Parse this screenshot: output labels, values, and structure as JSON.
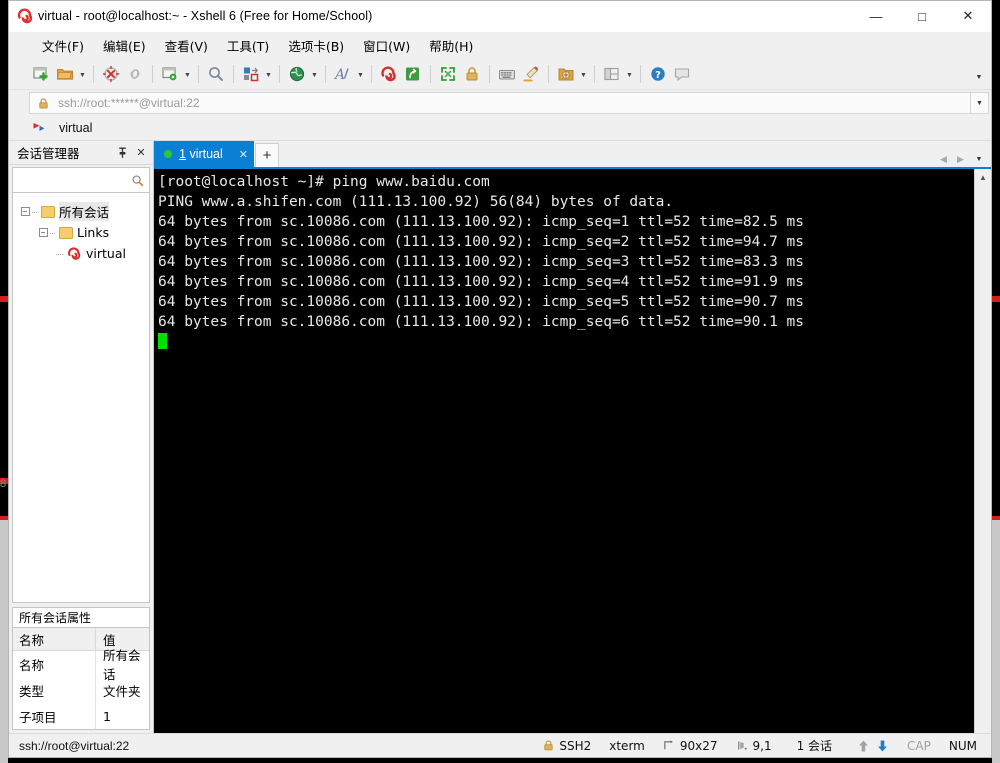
{
  "window": {
    "title": "virtual - root@localhost:~ - Xshell 6 (Free for Home/School)",
    "title_icon": "xshell-logo-icon",
    "minimize": "—",
    "maximize": "□",
    "close": "✕"
  },
  "menubar": {
    "items": [
      {
        "label": "文件(F)",
        "name": "menu-file"
      },
      {
        "label": "编辑(E)",
        "name": "menu-edit"
      },
      {
        "label": "查看(V)",
        "name": "menu-view"
      },
      {
        "label": "工具(T)",
        "name": "menu-tools"
      },
      {
        "label": "选项卡(B)",
        "name": "menu-tabs"
      },
      {
        "label": "窗口(W)",
        "name": "menu-window"
      },
      {
        "label": "帮助(H)",
        "name": "menu-help"
      }
    ]
  },
  "toolbar": {
    "overflow_caret": "▼",
    "buttons": [
      {
        "name": "new-session-icon",
        "caret": false
      },
      {
        "name": "open-folder-icon",
        "caret": true
      },
      {
        "sep": true
      },
      {
        "name": "disconnect-icon",
        "caret": false
      },
      {
        "name": "reconnect-icon",
        "caret": false
      },
      {
        "sep": true
      },
      {
        "name": "session-properties-icon",
        "caret": true
      },
      {
        "sep": true
      },
      {
        "name": "find-icon",
        "caret": false
      },
      {
        "sep": true
      },
      {
        "name": "transfer-icon",
        "caret": true
      },
      {
        "sep": true
      },
      {
        "name": "globe-icon",
        "caret": true
      },
      {
        "sep": true
      },
      {
        "name": "font-icon",
        "caret": true
      },
      {
        "sep": true
      },
      {
        "name": "xshell-icon",
        "caret": false
      },
      {
        "name": "xftp-icon",
        "caret": false
      },
      {
        "sep": true
      },
      {
        "name": "fullscreen-icon",
        "caret": false
      },
      {
        "name": "lock-icon",
        "caret": false
      },
      {
        "sep": true
      },
      {
        "name": "keyboard-icon",
        "caret": false
      },
      {
        "name": "highlight-icon",
        "caret": false
      },
      {
        "sep": true
      },
      {
        "name": "add-note-icon",
        "caret": true
      },
      {
        "sep": true
      },
      {
        "name": "layout-icon",
        "caret": true
      },
      {
        "sep": true
      },
      {
        "name": "help-icon",
        "caret": false
      },
      {
        "name": "comment-icon",
        "caret": false
      }
    ]
  },
  "address_bar": {
    "lock_icon": "lock-icon",
    "value": "ssh://root:******@virtual:22",
    "dropdown_caret": "▼"
  },
  "quick_bar": {
    "icon": "session-flag-icon",
    "label": "virtual"
  },
  "session_manager": {
    "title": "会话管理器",
    "pin_icon": "pin-icon",
    "close_icon": "close-icon",
    "search_icon": "search-icon",
    "search_value": "",
    "tree": [
      {
        "label": "所有会话",
        "indent": 0,
        "expander": "−",
        "icon": "folder-icon",
        "selected": true,
        "name": "tree-item-all-sessions"
      },
      {
        "label": "Links",
        "indent": 1,
        "expander": "−",
        "icon": "folder-icon",
        "selected": false,
        "name": "tree-item-links"
      },
      {
        "label": "virtual",
        "indent": 2,
        "expander": "",
        "icon": "xshell-session-icon",
        "selected": false,
        "name": "tree-item-virtual"
      }
    ]
  },
  "properties": {
    "title": "所有会话属性",
    "columns": [
      "名称",
      "值"
    ],
    "rows": [
      {
        "name": "名称",
        "value": "所有会话"
      },
      {
        "name": "类型",
        "value": "文件夹"
      },
      {
        "name": "子项目",
        "value": "1"
      }
    ]
  },
  "tabs": {
    "active": {
      "index": "1",
      "label": "virtual",
      "status_dot": "green",
      "close": "✕"
    },
    "new_tab": "+",
    "nav_prev": "◀",
    "nav_next": "▶",
    "nav_dropdown": "▼"
  },
  "terminal": {
    "scroll_up_icon": "▲",
    "lines": [
      "[root@localhost ~]# ping www.baidu.com",
      "PING www.a.shifen.com (111.13.100.92) 56(84) bytes of data.",
      "64 bytes from sc.10086.com (111.13.100.92): icmp_seq=1 ttl=52 time=82.5 ms",
      "64 bytes from sc.10086.com (111.13.100.92): icmp_seq=2 ttl=52 time=94.7 ms",
      "64 bytes from sc.10086.com (111.13.100.92): icmp_seq=3 ttl=52 time=83.3 ms",
      "64 bytes from sc.10086.com (111.13.100.92): icmp_seq=4 ttl=52 time=91.9 ms",
      "64 bytes from sc.10086.com (111.13.100.92): icmp_seq=5 ttl=52 time=90.7 ms",
      "64 bytes from sc.10086.com (111.13.100.92): icmp_seq=6 ttl=52 time=90.1 ms"
    ]
  },
  "status_bar": {
    "connection": "ssh://root@virtual:22",
    "protocol_icon": "lock-icon",
    "protocol": "SSH2",
    "terminal_type": "xterm",
    "size_icon": "screen-size-icon",
    "size": "90x27",
    "cursor_icon": "cursor-pos-icon",
    "cursor": "9,1",
    "sessions": "1 会话",
    "upload_icon": "arrow-up-icon",
    "download_icon": "arrow-down-icon",
    "cap": "CAP",
    "num": "NUM"
  },
  "backdrop": {
    "marks": [
      "8"
    ]
  },
  "colors": {
    "accent": "#0b7fd4",
    "terminal_bg": "#000000",
    "terminal_fg": "#e8e8e8",
    "cursor": "#00e000",
    "chrome": "#f0f0f0",
    "dot_green": "#2fc62f",
    "red_mark": "#cf2020"
  }
}
